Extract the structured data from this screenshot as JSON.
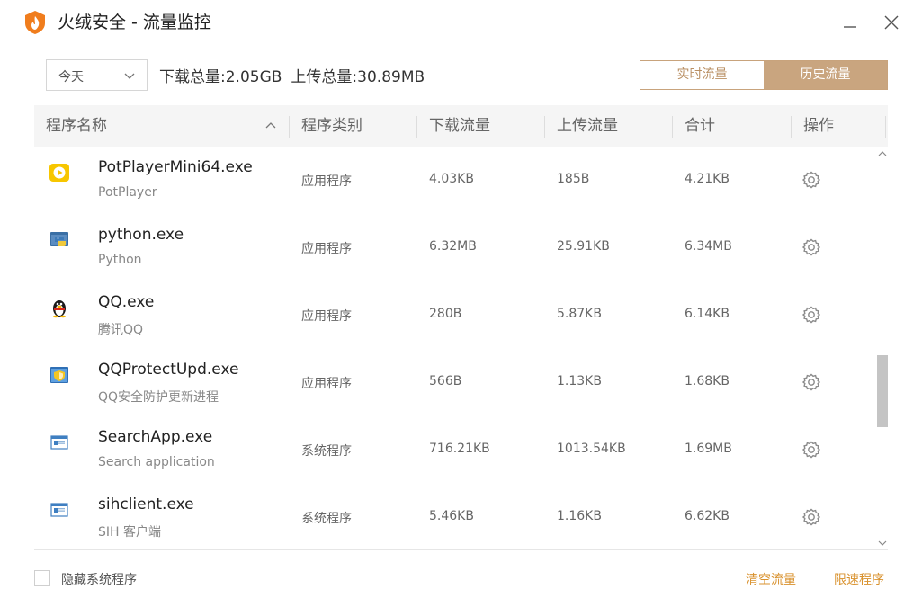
{
  "window": {
    "title": "火绒安全 - 流量监控",
    "brand_color": "#f07d1d"
  },
  "toolbar": {
    "date_select_value": "今天",
    "download_total_label": "下载总量:",
    "download_total_value": "2.05GB",
    "upload_total_label": "上传总量:",
    "upload_total_value": "30.89MB",
    "tab_live": "实时流量",
    "tab_history": "历史流量",
    "active_tab": "历史流量",
    "accent_color": "#c9a57f"
  },
  "table": {
    "headers": {
      "name": "程序名称",
      "category": "程序类别",
      "download": "下载流量",
      "upload": "上传流量",
      "total": "合计",
      "action": "操作"
    },
    "rows": [
      {
        "icon": "potplayer-icon",
        "name": "PotPlayerMini64.exe",
        "desc": "PotPlayer",
        "category": "应用程序",
        "download": "4.03KB",
        "upload": "185B",
        "total": "4.21KB"
      },
      {
        "icon": "python-icon",
        "name": "python.exe",
        "desc": "Python",
        "category": "应用程序",
        "download": "6.32MB",
        "upload": "25.91KB",
        "total": "6.34MB"
      },
      {
        "icon": "qq-penguin-icon",
        "name": "QQ.exe",
        "desc": "腾讯QQ",
        "category": "应用程序",
        "download": "280B",
        "upload": "5.87KB",
        "total": "6.14KB"
      },
      {
        "icon": "qq-protect-icon",
        "name": "QQProtectUpd.exe",
        "desc": "QQ安全防护更新进程",
        "category": "应用程序",
        "download": "566B",
        "upload": "1.13KB",
        "total": "1.68KB"
      },
      {
        "icon": "window-app-icon",
        "name": "SearchApp.exe",
        "desc": "Search application",
        "category": "系统程序",
        "download": "716.21KB",
        "upload": "1013.54KB",
        "total": "1.69MB"
      },
      {
        "icon": "window-app-icon",
        "name": "sihclient.exe",
        "desc": "SIH 客户端",
        "category": "系统程序",
        "download": "5.46KB",
        "upload": "1.16KB",
        "total": "6.62KB"
      }
    ]
  },
  "footer": {
    "hide_system_label": "隐藏系统程序",
    "hide_system_checked": false,
    "clear_link": "清空流量",
    "limit_link": "限速程序",
    "link_color": "#d9922e"
  }
}
